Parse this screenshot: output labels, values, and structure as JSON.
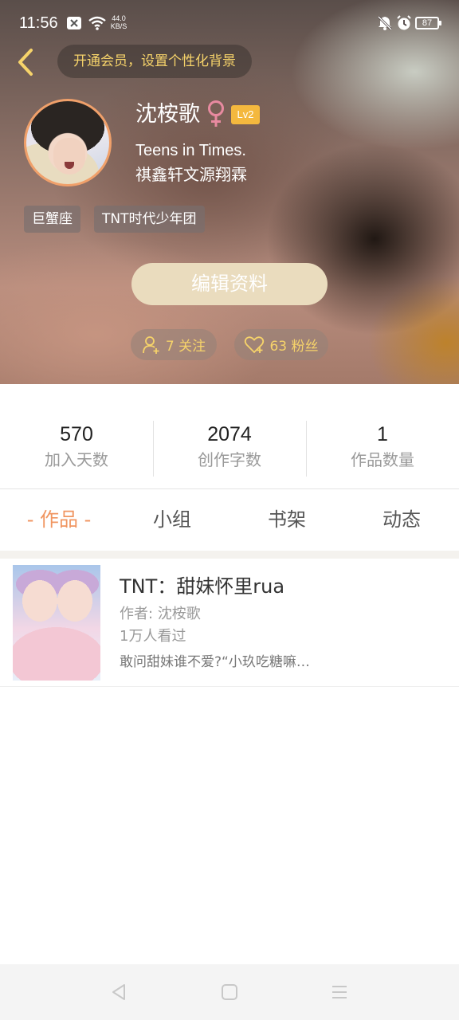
{
  "status_bar": {
    "time": "11:56",
    "net_speed_value": "44.0",
    "net_speed_unit": "KB/S",
    "battery": "87"
  },
  "header": {
    "vip_banner": "开通会员，设置个性化背景",
    "user_name": "沈桉歌",
    "level": "Lv2",
    "bio_line1": "Teens in Times.",
    "bio_line2": "祺鑫轩文源翔霖",
    "tags": [
      "巨蟹座",
      "TNT时代少年团"
    ],
    "edit_button": "编辑资料",
    "following": "7 关注",
    "followers": "63 粉丝"
  },
  "stats": [
    {
      "value": "570",
      "label": "加入天数"
    },
    {
      "value": "2074",
      "label": "创作字数"
    },
    {
      "value": "1",
      "label": "作品数量"
    }
  ],
  "tabs": [
    "- 作品 -",
    "小组",
    "书架",
    "动态"
  ],
  "works": [
    {
      "title": "TNT：甜妹怀里rua",
      "author": "作者: 沈桉歌",
      "views": "1万人看过",
      "description": "敢问甜妹谁不爱?“小玖吃糖嘛…"
    }
  ],
  "colors": {
    "accent_orange": "#f09560",
    "gold_text": "#f6d36a",
    "level_badge": "#f4b83e",
    "gender_pink": "#e88aa0",
    "edit_button_bg": "#eadcbe"
  },
  "icons": {
    "back": "chevron-left-icon",
    "gender": "female-icon",
    "following": "person-add-icon",
    "followers": "heart-icon"
  }
}
